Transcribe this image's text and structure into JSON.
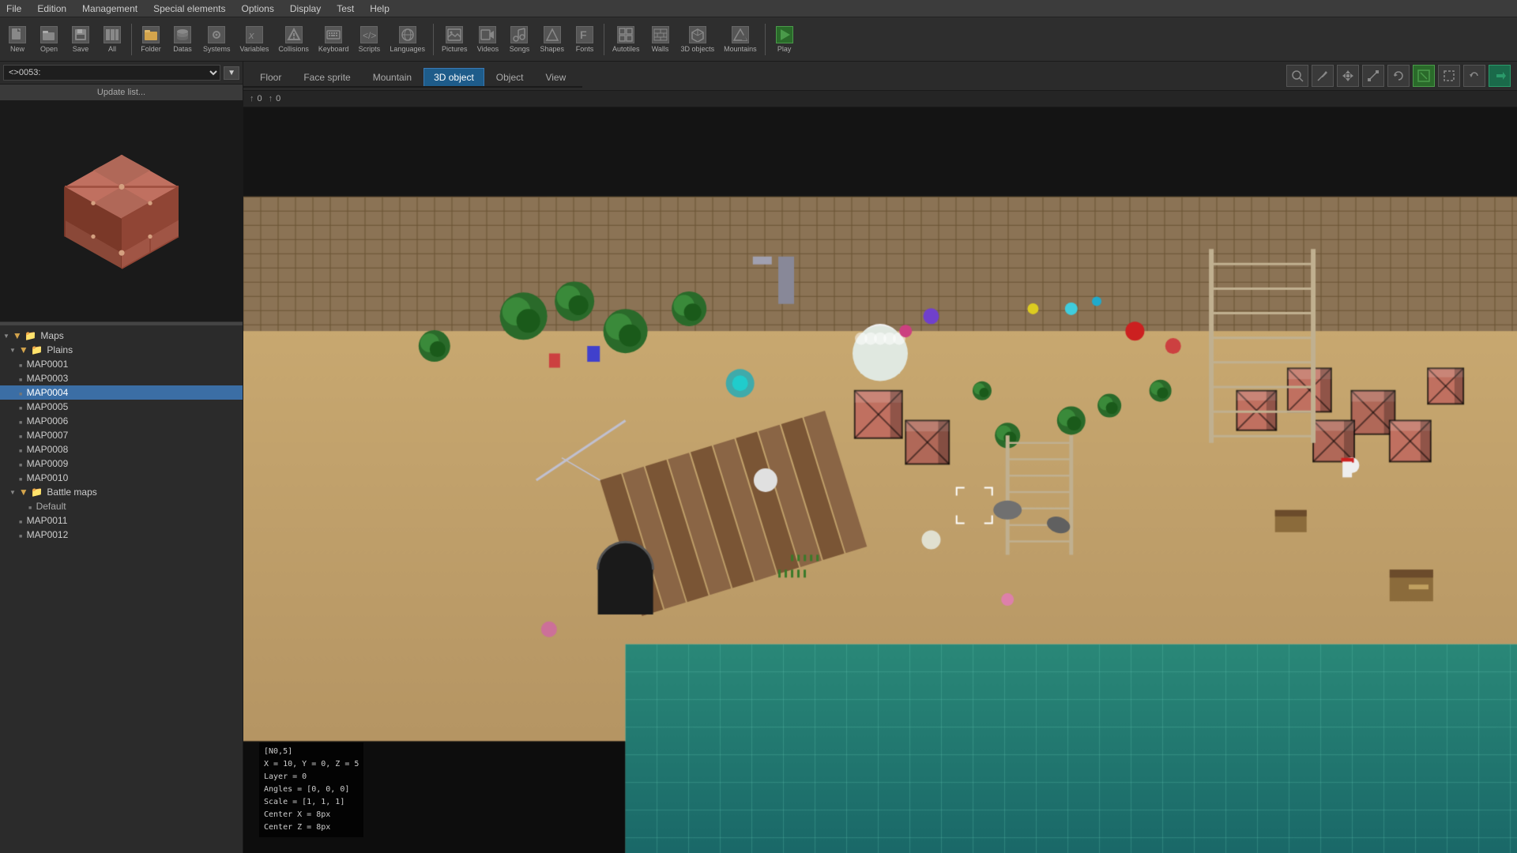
{
  "menubar": {
    "items": [
      "File",
      "Edition",
      "Management",
      "Special elements",
      "Options",
      "Display",
      "Test",
      "Help"
    ]
  },
  "toolbar": {
    "groups": [
      {
        "icon": "📄",
        "label": "New"
      },
      {
        "icon": "📂",
        "label": "Open"
      },
      {
        "icon": "💾",
        "label": "Save"
      },
      {
        "icon": "📋",
        "label": "All"
      },
      {
        "icon": "📁",
        "label": "Folder"
      },
      {
        "icon": "💾",
        "label": "Datas"
      },
      {
        "icon": "⚙",
        "label": "Systems"
      },
      {
        "icon": "𝑥",
        "label": "Variables"
      },
      {
        "icon": "💥",
        "label": "Collisions"
      },
      {
        "icon": "⌨",
        "label": "Keyboard"
      },
      {
        "icon": "📜",
        "label": "Scripts"
      },
      {
        "icon": "🌐",
        "label": "Languages"
      },
      {
        "icon": "🖼",
        "label": "Pictures"
      },
      {
        "icon": "🎬",
        "label": "Videos"
      },
      {
        "icon": "🎵",
        "label": "Songs"
      },
      {
        "icon": "⬡",
        "label": "Shapes"
      },
      {
        "icon": "F",
        "label": "Fonts"
      },
      {
        "icon": "🔲",
        "label": "Autotiles"
      },
      {
        "icon": "🧱",
        "label": "Walls"
      },
      {
        "icon": "📦",
        "label": "3D objects"
      },
      {
        "icon": "⛰",
        "label": "Mountains"
      },
      {
        "icon": "▶",
        "label": "Play"
      }
    ]
  },
  "left_panel": {
    "selector": {
      "value": "<>0053:",
      "placeholder": "<>0053:"
    },
    "update_btn": "Update list...",
    "tree": {
      "items": [
        {
          "level": 0,
          "type": "arrow-down",
          "icon": "folder",
          "label": "Maps"
        },
        {
          "level": 1,
          "type": "arrow-down",
          "icon": "folder",
          "label": "Plains"
        },
        {
          "level": 2,
          "type": "sq",
          "icon": "file",
          "label": "MAP0001"
        },
        {
          "level": 2,
          "type": "sq",
          "icon": "file",
          "label": "MAP0003"
        },
        {
          "level": 2,
          "type": "sq",
          "icon": "file",
          "label": "MAP0004",
          "selected": true
        },
        {
          "level": 2,
          "type": "sq",
          "icon": "file",
          "label": "MAP0005"
        },
        {
          "level": 2,
          "type": "sq",
          "icon": "file",
          "label": "MAP0006"
        },
        {
          "level": 2,
          "type": "sq",
          "icon": "file",
          "label": "MAP0007"
        },
        {
          "level": 2,
          "type": "sq",
          "icon": "file",
          "label": "MAP0008"
        },
        {
          "level": 2,
          "type": "sq",
          "icon": "file",
          "label": "MAP0009"
        },
        {
          "level": 2,
          "type": "sq",
          "icon": "file",
          "label": "MAP0010"
        },
        {
          "level": 1,
          "type": "arrow-down",
          "icon": "folder",
          "label": "Battle maps"
        },
        {
          "level": 2,
          "type": "sq",
          "icon": "file",
          "label": "Default"
        },
        {
          "level": 2,
          "type": "sq",
          "icon": "file",
          "label": "MAP0011"
        },
        {
          "level": 2,
          "type": "sq",
          "icon": "file",
          "label": "MAP0012"
        }
      ]
    }
  },
  "right_panel": {
    "tabs": [
      {
        "label": "Floor",
        "active": false
      },
      {
        "label": "Face sprite",
        "active": false
      },
      {
        "label": "Mountain",
        "active": false
      },
      {
        "label": "3D object",
        "active": true
      },
      {
        "label": "Object",
        "active": false
      },
      {
        "label": "View",
        "active": false
      }
    ],
    "coords": [
      {
        "arrow": "↑",
        "value": "0"
      },
      {
        "arrow": "↑",
        "value": "0"
      }
    ],
    "toolbar_buttons": [
      {
        "icon": "🔍",
        "tooltip": "zoom",
        "active": false
      },
      {
        "icon": "+",
        "tooltip": "add",
        "active": false
      },
      {
        "icon": "↔",
        "tooltip": "move",
        "active": false
      },
      {
        "icon": "↕",
        "tooltip": "scale",
        "active": false
      },
      {
        "icon": "⟳",
        "tooltip": "rotate",
        "active": false
      },
      {
        "icon": "✏",
        "tooltip": "draw",
        "active": true,
        "type": "active"
      },
      {
        "icon": "⬜",
        "tooltip": "select",
        "active": false
      },
      {
        "icon": "◀",
        "tooltip": "prev",
        "active": false
      },
      {
        "icon": "▶",
        "tooltip": "next",
        "active": true,
        "type": "active-teal"
      }
    ],
    "info_overlay": {
      "line1": "[N0,5]",
      "line2": "X = 10, Y = 0, Z = 5",
      "line3": "Layer = 0",
      "line4": "Angles = [0, 0, 0]",
      "line5": "Scale = [1, 1, 1]",
      "line6": "Center X = 8px",
      "line7": "Center Z = 8px"
    }
  }
}
